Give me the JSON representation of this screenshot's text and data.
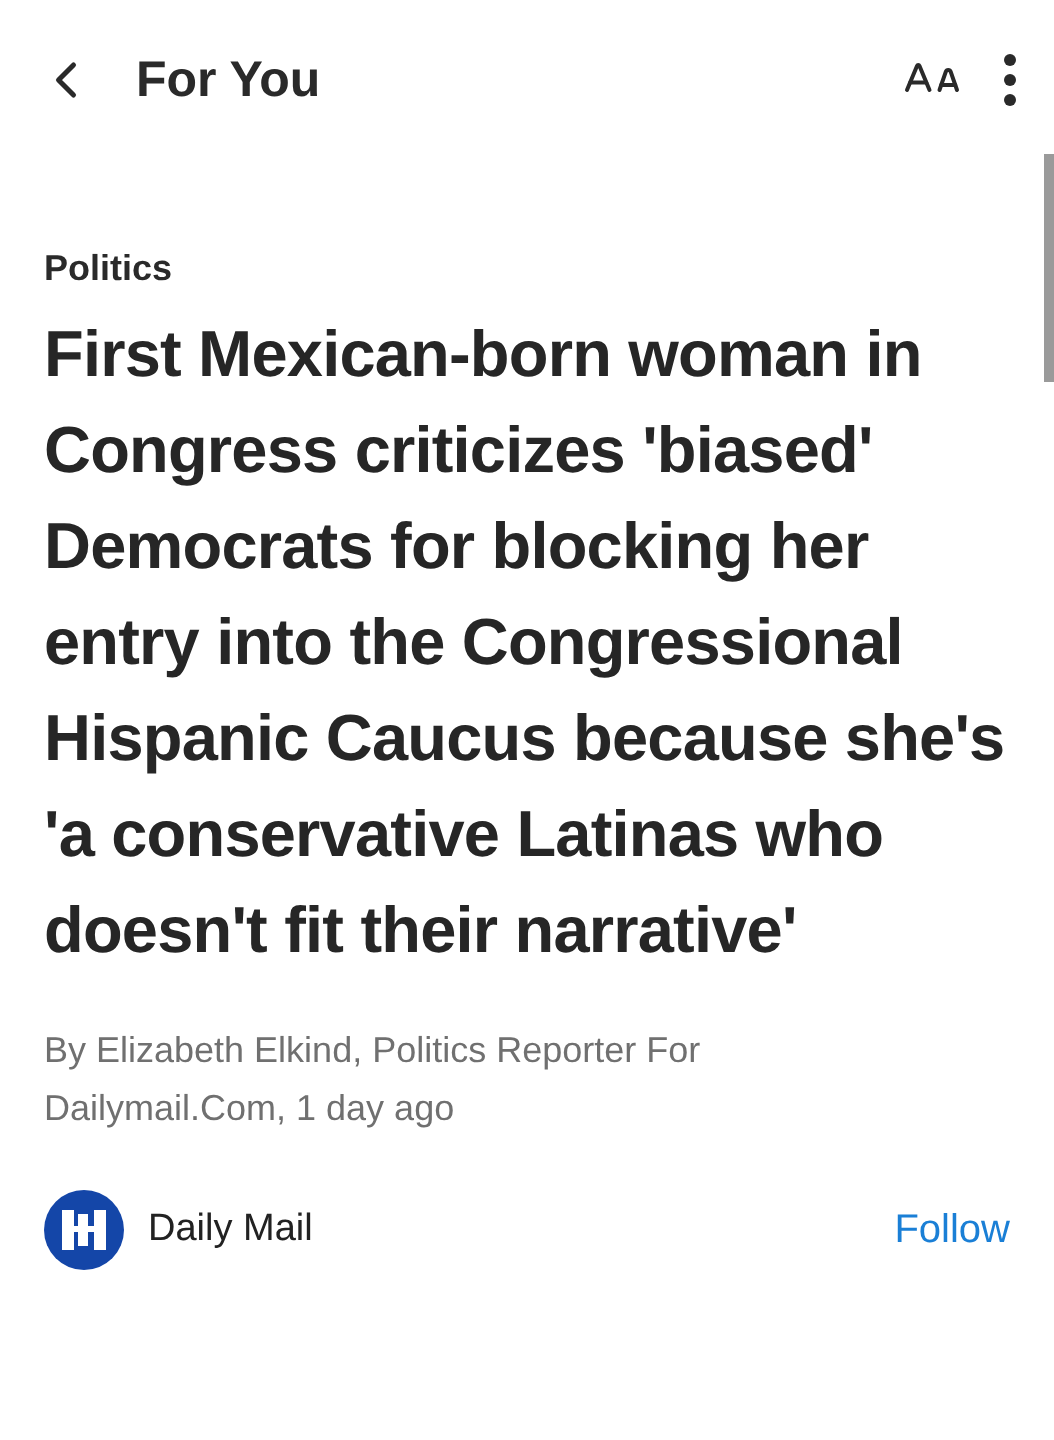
{
  "header": {
    "title": "For You"
  },
  "article": {
    "category": "Politics",
    "headline": "First Mexican-born woman in Congress criticizes 'biased' Democrats for blocking her entry into the Congressional Hispanic Caucus because she's 'a conservative Latinas who doesn't fit their narrative'",
    "byline": "By Elizabeth Elkind, Politics Reporter For Dailymail.Com, 1 day ago"
  },
  "publisher": {
    "name": "Daily Mail",
    "follow_label": "Follow",
    "following": false
  }
}
